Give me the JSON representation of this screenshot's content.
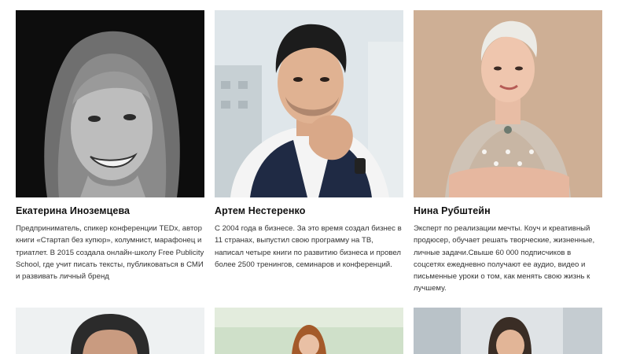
{
  "speakers": [
    {
      "name": "Екатерина Иноземцева",
      "bio": "Предприниматель, спикер конференции TEDx, автор книги «Стартап без купюр», колумнист, марафонец и триатлет. В 2015 создала онлайн-школу Free Publicity School, где учит писать тексты, публиковаться в СМИ и развивать личный бренд",
      "photo_style": "black-and-white"
    },
    {
      "name": "Артем Нестеренко",
      "bio": "С 2004 года в бизнесе. За это время создал бизнес в 11 странах, выпустил свою программу на ТВ, написал четыре книги по развитию бизнеса и провел более 2500 тренингов, семинаров и конференций.",
      "photo_style": "color"
    },
    {
      "name": "Нина Рубштейн",
      "bio": "Эксперт по реализации мечты. Коуч и креативный продюсер, обучает решать творческие, жизненные, личные задачи.Свыше 60 000 подписчиков в соцсетях ежедневно получают ее аудио, видео и письменные уроки о том, как менять свою жизнь к лучшему.",
      "photo_style": "color"
    }
  ],
  "next_row_photos": [
    {
      "photo_style": "color"
    },
    {
      "photo_style": "color"
    },
    {
      "photo_style": "color"
    }
  ]
}
